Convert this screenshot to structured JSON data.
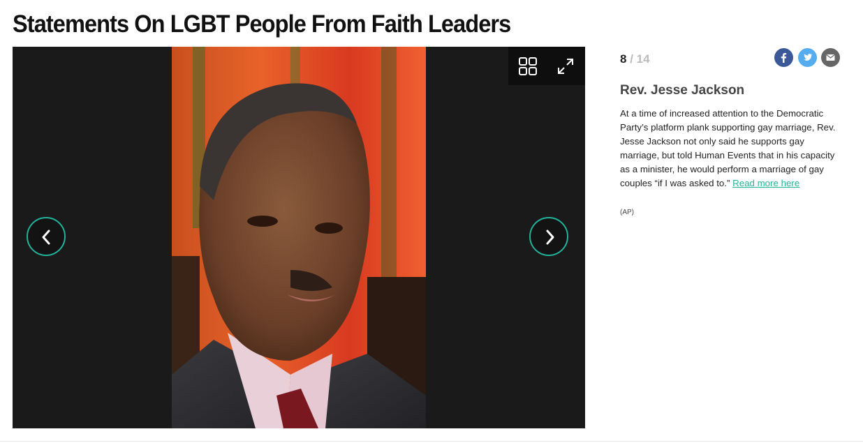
{
  "page": {
    "title": "Statements On LGBT People From Faith Leaders"
  },
  "gallery": {
    "current": "8",
    "separator": "/",
    "total": "14",
    "photo_alt": "Rev. Jesse Jackson",
    "accent_color": "#23b39a",
    "icons": {
      "grid": "grid-view-icon",
      "expand": "fullscreen-expand-icon",
      "prev": "chevron-left-icon",
      "next": "chevron-right-icon"
    }
  },
  "share": {
    "facebook_color": "#3b5998",
    "twitter_color": "#55acee",
    "email_color": "#666666"
  },
  "slide": {
    "heading": "Rev. Jesse Jackson",
    "body": "At a time of increased attention to the Democratic Party’s platform plank supporting gay marriage, Rev. Jesse Jackson not only said he supports gay marriage, but told Human Events that in his capacity as a minister, he would perform a marriage of gay couples “if I was asked to.”",
    "link_text": "Read more here",
    "credit": "(AP)"
  }
}
